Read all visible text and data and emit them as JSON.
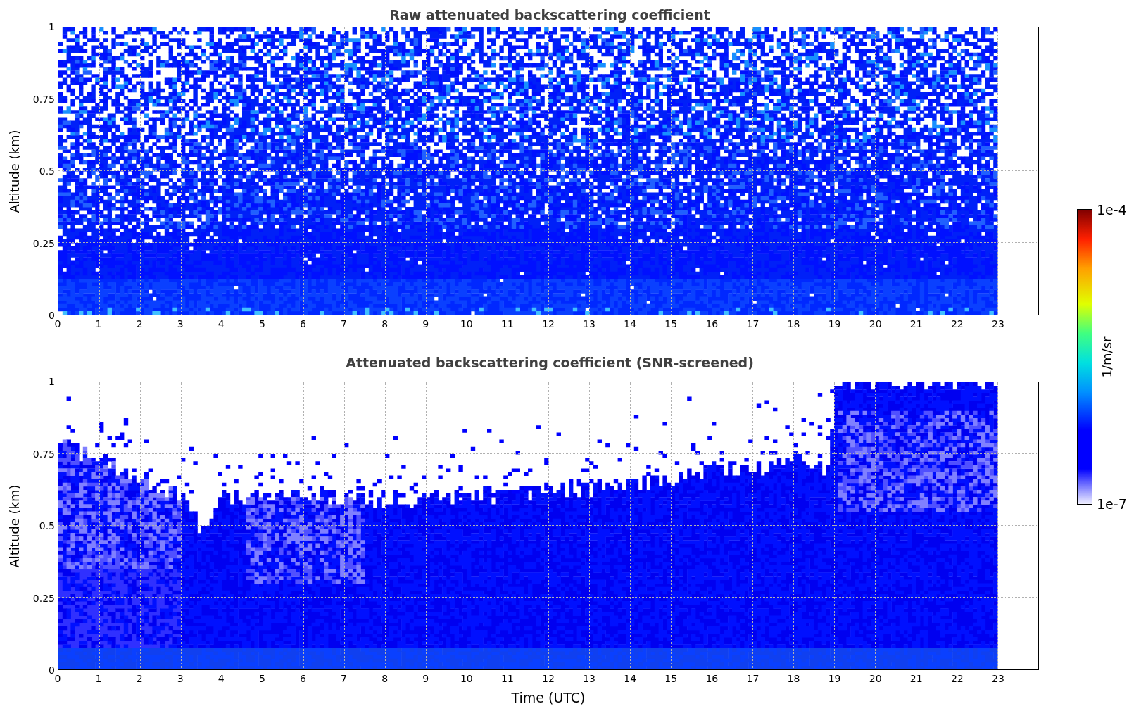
{
  "panels": [
    {
      "kind": "raw",
      "title": "Raw attenuated backscattering coefficient",
      "ylabel": "Altitude (km)",
      "yticks": [
        "1",
        "0.75",
        "0.5",
        "0.25",
        "0"
      ],
      "xticks": [
        "0",
        "1",
        "2",
        "3",
        "4",
        "5",
        "6",
        "7",
        "8",
        "9",
        "10",
        "11",
        "12",
        "13",
        "14",
        "15",
        "16",
        "17",
        "18",
        "19",
        "20",
        "21",
        "22",
        "23"
      ]
    },
    {
      "kind": "screened",
      "title": "Attenuated backscattering coefficient (SNR-screened)",
      "ylabel": "Altitude (km)",
      "yticks": [
        "1",
        "0.75",
        "0.5",
        "0.25",
        "0"
      ],
      "xticks": [
        "0",
        "1",
        "2",
        "3",
        "4",
        "5",
        "6",
        "7",
        "8",
        "9",
        "10",
        "11",
        "12",
        "13",
        "14",
        "15",
        "16",
        "17",
        "18",
        "19",
        "20",
        "21",
        "22",
        "23"
      ],
      "xlabel": "Time (UTC)"
    }
  ],
  "colorbar": {
    "max_label": "1e-4",
    "min_label": "1e-7",
    "label": "1/m/sr"
  }
}
